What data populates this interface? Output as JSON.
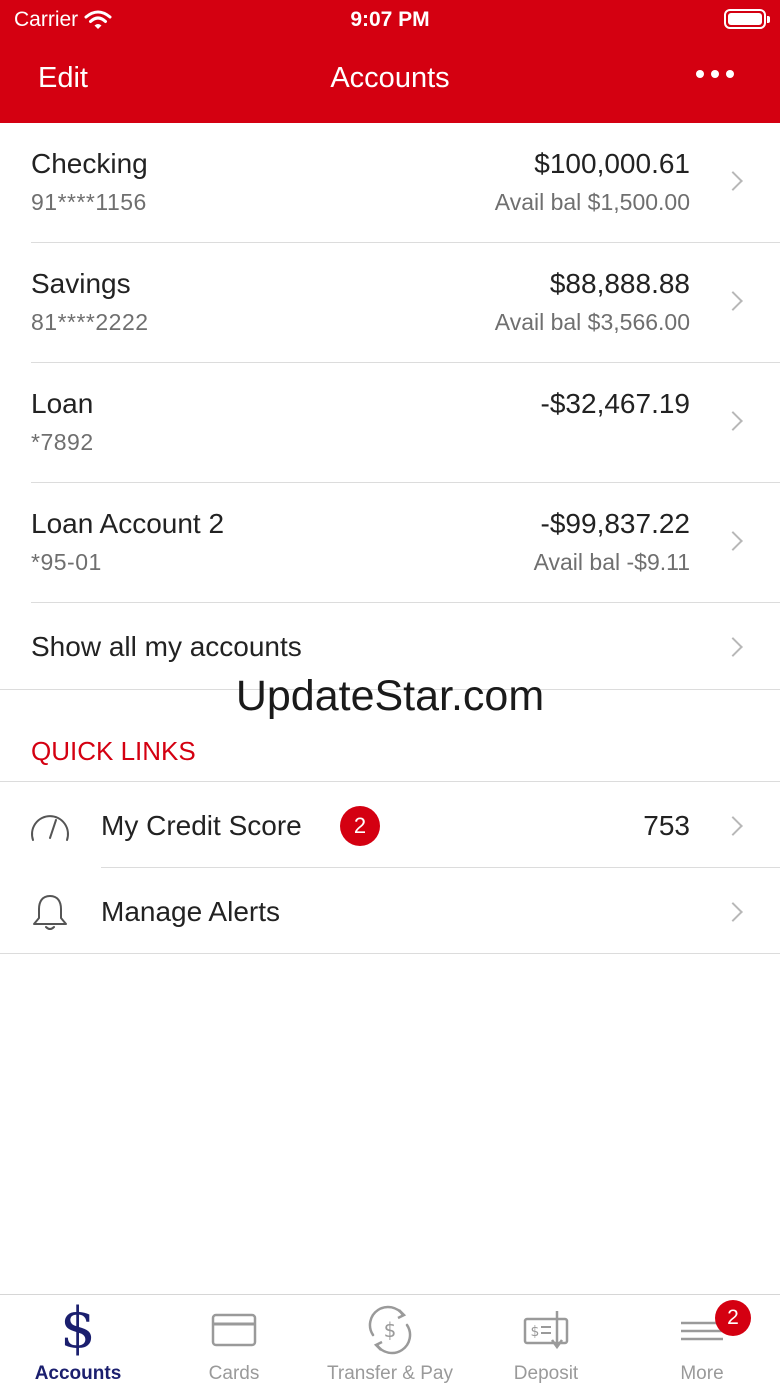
{
  "status_bar": {
    "carrier": "Carrier",
    "time": "9:07 PM"
  },
  "header": {
    "edit_label": "Edit",
    "title": "Accounts"
  },
  "accounts": [
    {
      "name": "Checking",
      "number": "91****1156",
      "balance": "$100,000.61",
      "available": "Avail bal $1,500.00"
    },
    {
      "name": "Savings",
      "number": "81****2222",
      "balance": "$88,888.88",
      "available": "Avail bal $3,566.00"
    },
    {
      "name": "Loan",
      "number": "*7892",
      "balance": "-$32,467.19",
      "available": ""
    },
    {
      "name": "Loan Account 2",
      "number": "*95-01",
      "balance": "-$99,837.22",
      "available": "Avail bal -$9.11"
    }
  ],
  "show_all_label": "Show all my accounts",
  "watermark": "UpdateStar.com",
  "quick_links": {
    "title": "QUICK LINKS",
    "items": [
      {
        "label": "My Credit Score",
        "badge": "2",
        "value": "753",
        "icon": "speedometer-icon"
      },
      {
        "label": "Manage Alerts",
        "icon": "bell-icon"
      }
    ]
  },
  "tabbar": {
    "items": [
      {
        "label": "Accounts",
        "icon": "dollar-icon",
        "active": true
      },
      {
        "label": "Cards",
        "icon": "card-icon"
      },
      {
        "label": "Transfer & Pay",
        "icon": "transfer-icon"
      },
      {
        "label": "Deposit",
        "icon": "check-deposit-icon"
      },
      {
        "label": "More",
        "icon": "hamburger-icon",
        "badge": "2"
      }
    ]
  },
  "colors": {
    "brand_red": "#d40011",
    "active_tab": "#1b1f6e",
    "inactive_tab": "#9a9a9a"
  }
}
